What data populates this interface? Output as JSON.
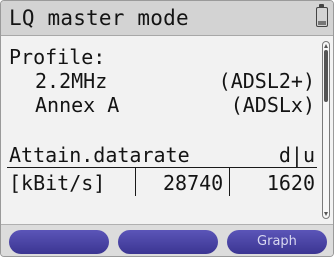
{
  "title": "LQ master mode",
  "icons": {
    "battery": "battery-icon"
  },
  "profile": {
    "label": "Profile:",
    "rows": [
      {
        "left": "2.2MHz",
        "right": "(ADSL2+)"
      },
      {
        "left": "Annex A",
        "right": "(ADSLx)"
      }
    ]
  },
  "table": {
    "header_left": "Attain.datarate",
    "header_right": "d|u",
    "unit": "[kBit/s]",
    "down": "28740",
    "up": "1620"
  },
  "softkeys": [
    "",
    "",
    "Graph"
  ],
  "colors": {
    "title_bar": "#d3d3d3",
    "softkey": "#3f3a9a",
    "background": "#f2f2f2"
  }
}
